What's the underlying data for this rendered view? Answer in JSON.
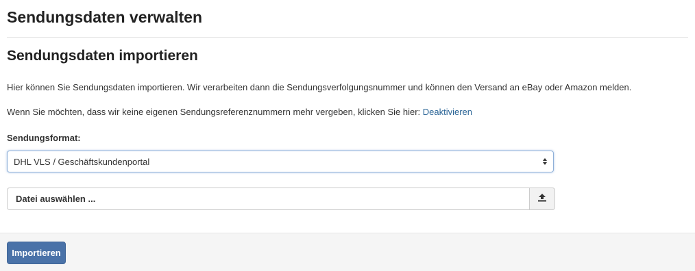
{
  "header": {
    "title": "Sendungsdaten verwalten"
  },
  "section": {
    "title": "Sendungsdaten importieren",
    "intro_text": "Hier können Sie Sendungsdaten importieren. Wir verarbeiten dann die Sendungsverfolgungsnummer und können den Versand an eBay oder Amazon melden.",
    "deactivate_text": "Wenn Sie möchten, dass wir keine eigenen Sendungsreferenznummern mehr vergeben, klicken Sie hier: ",
    "deactivate_link": "Deaktivieren"
  },
  "form": {
    "format_label": "Sendungsformat:",
    "format_selected": "DHL VLS / Geschäftskundenportal",
    "file_placeholder": "Datei auswählen ...",
    "upload_icon": "upload-icon",
    "select_icon": "select-arrows-icon"
  },
  "footer": {
    "submit_label": "Importieren"
  },
  "colors": {
    "link": "#2a6496",
    "primary_button": "#4a72a8",
    "footer_bg": "#f5f5f5"
  }
}
